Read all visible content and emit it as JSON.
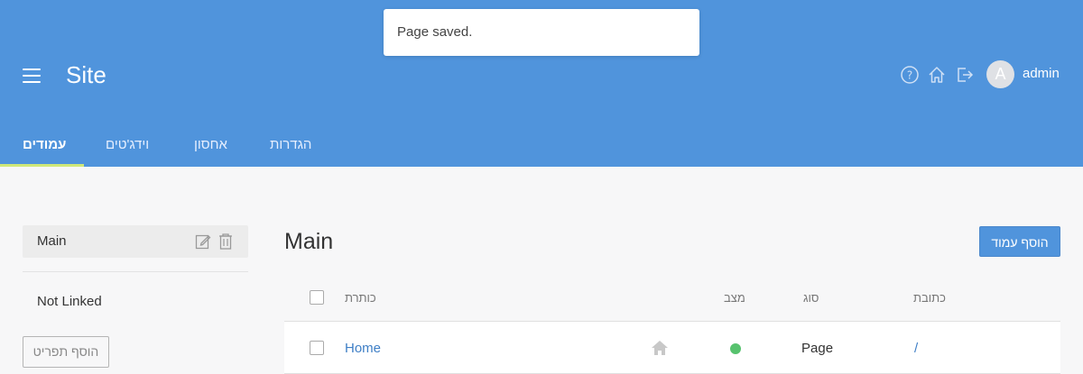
{
  "header": {
    "site_title": "Site",
    "username": "admin",
    "avatar_initial": "A",
    "icons": [
      "help-icon",
      "home-icon",
      "logout-icon"
    ],
    "colors": {
      "header_bg": "#5094dc",
      "tab_active_underline": "#cfe879"
    }
  },
  "toast": {
    "message": "Page saved."
  },
  "tabs": [
    {
      "label": "עמודים",
      "active": true
    },
    {
      "label": "וידג'טים",
      "active": false
    },
    {
      "label": "אחסון",
      "active": false
    },
    {
      "label": "הגדרות",
      "active": false
    }
  ],
  "sidebar": {
    "items": [
      {
        "label": "Main",
        "selected": true
      },
      {
        "label": "Not Linked",
        "selected": false
      }
    ],
    "add_item_label": "הוסף תפריט"
  },
  "main": {
    "title": "Main",
    "add_page_label": "הוסף עמוד",
    "table": {
      "headers": {
        "title": "כותרת",
        "status": "מצב",
        "type": "סוג",
        "address": "כתובת"
      },
      "rows": [
        {
          "title": "Home",
          "is_home": true,
          "status": "published",
          "status_color": "#57c26e",
          "type": "Page",
          "address": "/"
        }
      ]
    }
  }
}
